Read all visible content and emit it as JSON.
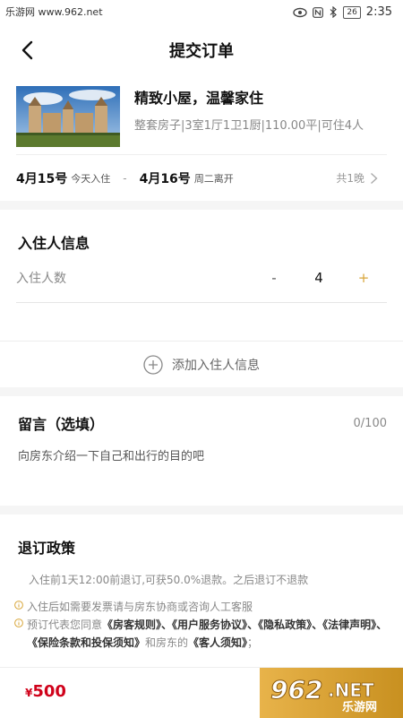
{
  "status_bar": {
    "watermark": "乐游网 www.962.net",
    "time": "2:35",
    "battery": "26"
  },
  "nav": {
    "title": "提交订单"
  },
  "listing": {
    "name": "精致小屋，温馨家住",
    "description": "整套房子|3室1厅1卫1厨|110.00平|可住4人"
  },
  "dates": {
    "checkin_date": "4月15号",
    "checkin_label": "今天入住",
    "separator": "-",
    "checkout_date": "4月16号",
    "checkout_label": "周二离开",
    "nights": "共1晚"
  },
  "guests": {
    "section_title": "入住人信息",
    "count_label": "入住人数",
    "minus": "-",
    "count": "4",
    "plus": "+",
    "add_label": "添加入住人信息"
  },
  "message": {
    "title": "留言（选填）",
    "counter": "0/100",
    "placeholder": "向房东介绍一下自己和出行的目的吧"
  },
  "policy": {
    "title": "退订政策",
    "rule": "入住前1天12:00前退订,可获50.0%退款。之后退订不退款",
    "note1": "入住后如需要发票请与房东协商或咨询人工客服",
    "note2_prefix": "预订代表您同意",
    "doc1": "《房客规则》",
    "sep": "、",
    "doc2": "《用户服务协议》",
    "doc3": "《隐私政策》",
    "doc4": "《法律声明》",
    "doc5": "《保险条款和投保须知》",
    "note2_mid": "和房东的",
    "doc6": "《客人须知》",
    "note2_end": "；"
  },
  "footer": {
    "currency": "¥",
    "price": "500",
    "logo_number": "962",
    "logo_net": ".NET",
    "logo_cn": "乐游网"
  },
  "colors": {
    "price": "#d0021b",
    "accent": "#d8a63a",
    "submit": "#d9a33a"
  }
}
